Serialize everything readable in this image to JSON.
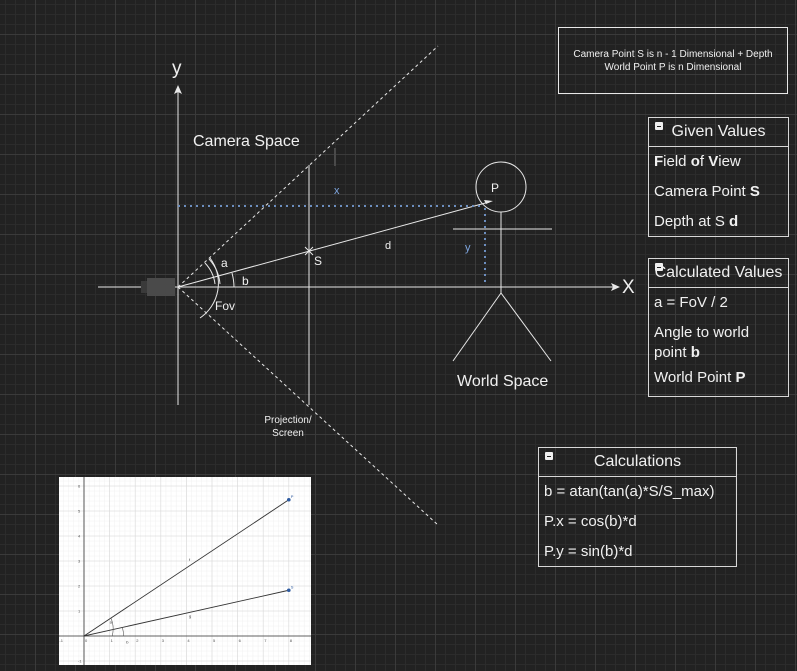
{
  "labels": {
    "axis_y": "y",
    "axis_x": "X",
    "camera_space": "Camera Space",
    "world_space": "World Space",
    "point_p": "P",
    "point_s": "S",
    "seg_x": "x",
    "seg_y": "y",
    "seg_d": "d",
    "angle_a": "a",
    "angle_b": "b",
    "fov": "Fov",
    "projection_line1": "Projection/",
    "projection_line2": "Screen"
  },
  "note": {
    "line1": "Camera Point S is n - 1 Dimensional + Depth",
    "line2": "World Point P is n Dimensional"
  },
  "given_values": {
    "title": "Given Values",
    "rows": [
      {
        "parts": [
          [
            "F",
            true
          ],
          [
            "ield ",
            false
          ],
          [
            "o",
            true
          ],
          [
            "f ",
            false
          ],
          [
            "V",
            true
          ],
          [
            "iew",
            false
          ]
        ]
      },
      {
        "parts": [
          [
            "Camera Point ",
            false
          ],
          [
            "S",
            true
          ]
        ]
      },
      {
        "parts": [
          [
            "Depth at S ",
            false
          ],
          [
            "d",
            true
          ]
        ]
      }
    ]
  },
  "calculated_values": {
    "title": "Calculated Values",
    "rows": [
      {
        "parts": [
          [
            "a = FoV / 2",
            false
          ]
        ]
      },
      {
        "parts": [
          [
            "Angle to world point ",
            false
          ],
          [
            "b",
            true
          ]
        ]
      },
      {
        "parts": [
          [
            "World Point ",
            false
          ],
          [
            "P",
            true
          ]
        ]
      }
    ]
  },
  "calculations": {
    "title": "Calculations",
    "rows": [
      {
        "parts": [
          [
            "b = atan(tan(a)*S/S_max)",
            false
          ]
        ]
      },
      {
        "parts": [
          [
            "P.x = cos(b)*d",
            false
          ]
        ]
      },
      {
        "parts": [
          [
            "P.y = sin(b)*d",
            false
          ]
        ]
      }
    ]
  },
  "thumbnail": {
    "x_ticks": [
      "-1",
      "0",
      "1",
      "2",
      "3",
      "4",
      "5",
      "6",
      "7",
      "8",
      "9"
    ],
    "y_ticks": [
      "-1",
      "1",
      "2",
      "3",
      "4",
      "5",
      "6"
    ],
    "point_top": "P",
    "point_bottom": "S",
    "line_f": "f",
    "line_g": "g",
    "angle_a": "a",
    "angle_b": "b"
  },
  "colors": {
    "background": "#222222",
    "stroke": "#e8e8e8",
    "dotted": "#6c8ebf",
    "accent_label": "#7ea6e0"
  }
}
